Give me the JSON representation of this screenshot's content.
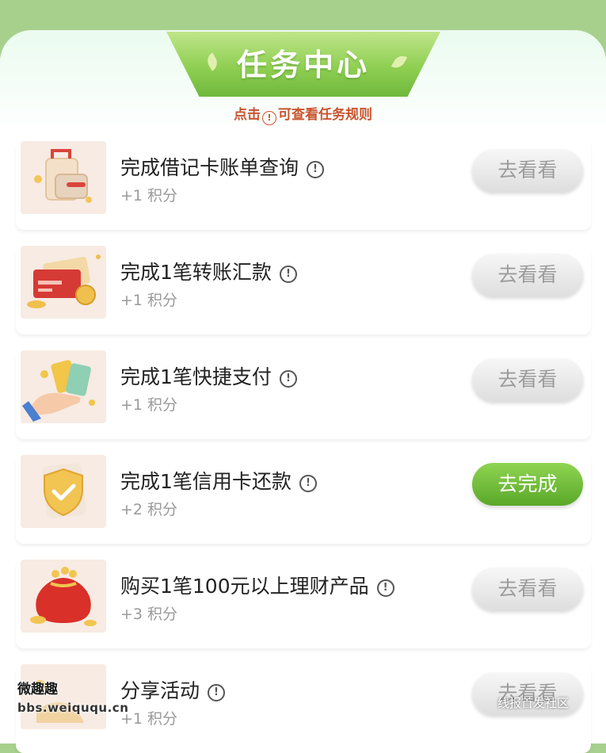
{
  "header": {
    "title": "任务中心",
    "hint_prefix": "点击",
    "hint_icon": "!",
    "hint_suffix": "可查看任务规则"
  },
  "colors": {
    "accent_green": "#6fb83d",
    "hint_red": "#c9552f",
    "page_bg": "#a8d08d"
  },
  "tasks": [
    {
      "title": "完成借记卡账单查询",
      "points": "+1 积分",
      "button": "去看看",
      "button_style": "gray",
      "icon": "shopping-bag-wallet-icon"
    },
    {
      "title": "完成1笔转账汇款",
      "points": "+1 积分",
      "button": "去看看",
      "button_style": "gray",
      "icon": "bank-card-transfer-icon"
    },
    {
      "title": "完成1笔快捷支付",
      "points": "+1 积分",
      "button": "去看看",
      "button_style": "gray",
      "icon": "hand-with-cards-icon"
    },
    {
      "title": "完成1笔信用卡还款",
      "points": "+2 积分",
      "button": "去完成",
      "button_style": "green",
      "icon": "shield-check-icon"
    },
    {
      "title": "购买1笔100元以上理财产品",
      "points": "+3 积分",
      "button": "去看看",
      "button_style": "gray",
      "icon": "money-bag-icon"
    },
    {
      "title": "分享活动",
      "points": "+1 积分",
      "button": "去看看",
      "button_style": "gray",
      "icon": "share-gift-icon"
    }
  ],
  "watermark": {
    "left_line1": "微趣趣",
    "left_line2": "bbs.weiququ.cn",
    "right": "线报首发社区"
  }
}
